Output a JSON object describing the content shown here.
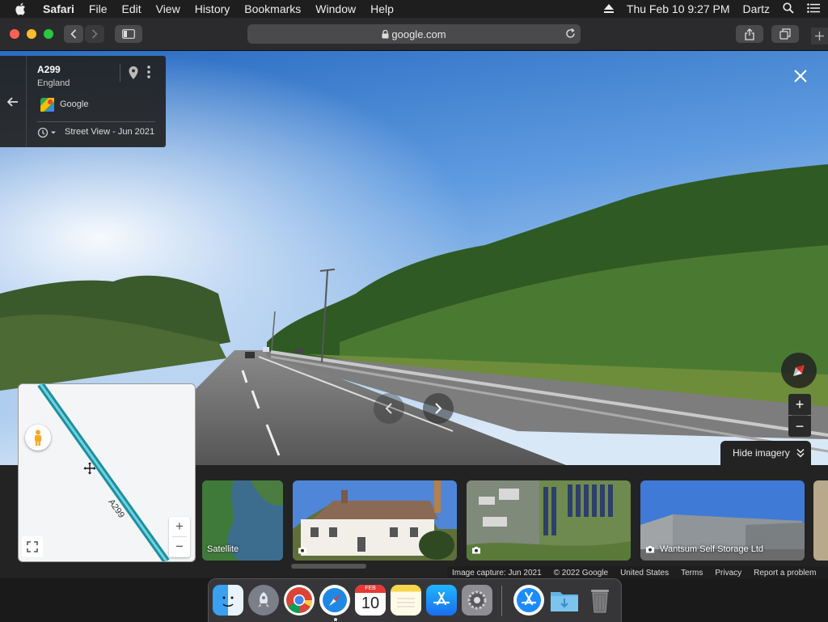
{
  "menubar": {
    "app": "Safari",
    "items": [
      "File",
      "Edit",
      "View",
      "History",
      "Bookmarks",
      "Window",
      "Help"
    ],
    "datetime": "Thu Feb 10  9:27 PM",
    "user": "Dartz"
  },
  "browser": {
    "url": "google.com"
  },
  "location_card": {
    "road": "A299",
    "region": "England",
    "provider": "Google",
    "history": "Street View - Jun 2021"
  },
  "minimap": {
    "road_label": "A299"
  },
  "controls": {
    "hide_imagery": "Hide imagery",
    "zoom_in": "+",
    "zoom_out": "−",
    "map_zoom_in": "+",
    "map_zoom_out": "−"
  },
  "thumbnails": [
    {
      "label": "Satellite"
    },
    {
      "label": ""
    },
    {
      "label": ""
    },
    {
      "label": "Wantsum Self Storage Ltd"
    }
  ],
  "footer": {
    "capture": "Image capture: Jun 2021",
    "copyright": "© 2022 Google",
    "country": "United States",
    "terms": "Terms",
    "privacy": "Privacy",
    "report": "Report a problem"
  },
  "dock": {
    "calendar_month": "FEB",
    "calendar_day": "10",
    "apps": [
      "Finder",
      "Launchpad",
      "Chrome",
      "Safari",
      "Calendar",
      "Notes",
      "App Store",
      "System Preferences",
      "App Store",
      "Downloads",
      "Trash"
    ]
  },
  "colors": {
    "road_accent": "#29a8b8",
    "sky_top": "#2a6fc4",
    "vegetation": "#3d6b2a"
  }
}
